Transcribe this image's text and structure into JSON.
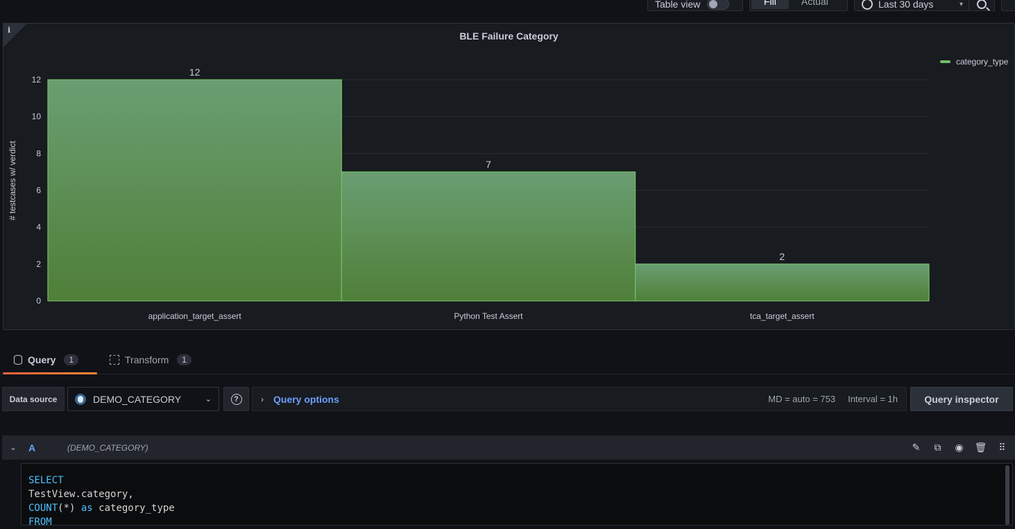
{
  "toolbar": {
    "table_view_label": "Table view",
    "fit_label": "Fill",
    "actual_label": "Actual",
    "time_range": "Last 30 days"
  },
  "panel": {
    "info_icon": "i",
    "title": "BLE Failure Category",
    "legend_label": "category_type",
    "series_color": "#73bf69"
  },
  "chart_data": {
    "type": "bar",
    "title": "BLE Failure Category",
    "categories": [
      "application_target_assert",
      "Python Test Assert",
      "tca_target_assert"
    ],
    "series": [
      {
        "name": "category_type",
        "values": [
          12,
          7,
          2
        ]
      }
    ],
    "ylabel": "# testcases w/ verdict",
    "xlabel": "",
    "ylim": [
      0,
      12
    ],
    "yticks": [
      0,
      2,
      4,
      6,
      8,
      10,
      12
    ],
    "grid": true,
    "legend": "right"
  },
  "tabs": [
    {
      "label": "Query",
      "count": "1"
    },
    {
      "label": "Transform",
      "count": "1"
    }
  ],
  "query_row": {
    "datasource_label": "Data source",
    "datasource_value": "DEMO_CATEGORY",
    "help_icon": "?",
    "options_label": "Query options",
    "md_text": "MD = auto = 753",
    "interval_text": "Interval = 1h",
    "inspector_label": "Query inspector"
  },
  "query": {
    "ref_id": "A",
    "ds_name": "(DEMO_CATEGORY)",
    "code_lines": [
      [
        {
          "t": "SELECT",
          "c": "kw"
        }
      ],
      [
        {
          "t": "TestView.category,",
          "c": "plain"
        }
      ],
      [
        {
          "t": "COUNT",
          "c": "kw"
        },
        {
          "t": "(*) ",
          "c": "plain"
        },
        {
          "t": "as",
          "c": "kw"
        },
        {
          "t": " category_type",
          "c": "plain"
        }
      ],
      [
        {
          "t": "FROM",
          "c": "kw"
        }
      ]
    ]
  }
}
